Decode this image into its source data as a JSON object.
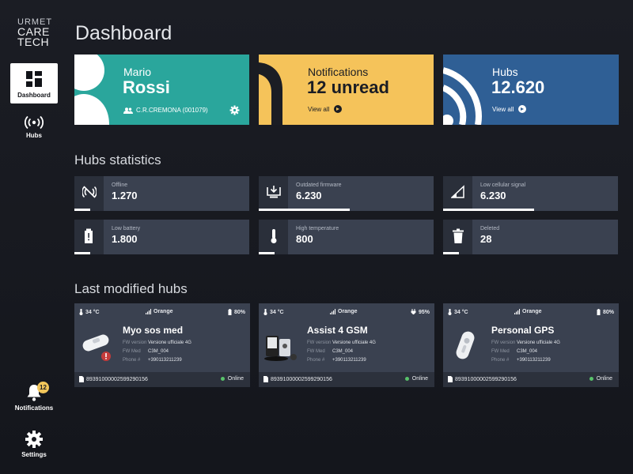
{
  "brand": {
    "line1": "URMET",
    "line2": "CARE",
    "line3": "TECH"
  },
  "sidebar": {
    "items": [
      {
        "label": "Dashboard",
        "icon": "dashboard-icon"
      },
      {
        "label": "Hubs",
        "icon": "hubs-icon"
      },
      {
        "label": "Notifications",
        "icon": "bell-icon",
        "badge": "12"
      },
      {
        "label": "Settings",
        "icon": "gear-icon"
      }
    ]
  },
  "page_title": "Dashboard",
  "cards": {
    "user": {
      "first_name": "Mario",
      "last_name": "Rossi",
      "group": "C.R.CREMONA (001079)"
    },
    "notifications": {
      "label": "Notifications",
      "value": "12 unread",
      "link": "View all"
    },
    "hubs": {
      "label": "Hubs",
      "value": "12.620",
      "link": "View all"
    }
  },
  "sections": {
    "stats": "Hubs statistics",
    "last_modified": "Last modified hubs"
  },
  "stats": [
    {
      "label": "Offline",
      "value": "1.270",
      "icon": "signal-off-icon",
      "fill": 0.09
    },
    {
      "label": "Outdated firmware",
      "value": "6.230",
      "icon": "download-icon",
      "fill": 0.52
    },
    {
      "label": "Low cellular signal",
      "value": "6.230",
      "icon": "low-signal-icon",
      "fill": 0.52
    },
    {
      "label": "Low battery",
      "value": "1.800",
      "icon": "battery-low-icon",
      "fill": 0.09
    },
    {
      "label": "High temperature",
      "value": "800",
      "icon": "thermometer-icon",
      "fill": 0.09
    },
    {
      "label": "Deleted",
      "value": "28",
      "icon": "trash-icon",
      "fill": 0.09
    }
  ],
  "hubs": [
    {
      "temp": "34 °C",
      "network": "Orange",
      "battery": "80%",
      "battery_icon": "battery-icon",
      "name": "Myo sos med",
      "fw_label": "FW version",
      "fw": "Versione ufficiale 4G",
      "fwmed_label": "FW Med",
      "fwmed": "C3M_004",
      "phone_label": "Phone #",
      "phone": "+390113211239",
      "imei": "89391000002599290156",
      "status": "Online"
    },
    {
      "temp": "34 °C",
      "network": "Orange",
      "battery": "95%",
      "battery_icon": "plug-icon",
      "name": "Assist 4 GSM",
      "fw_label": "FW version",
      "fw": "Versione ufficiale 4G",
      "fwmed_label": "FW Med",
      "fwmed": "C3M_004",
      "phone_label": "Phone #",
      "phone": "+390113211239",
      "imei": "89391000002599290156",
      "status": "Online"
    },
    {
      "temp": "34 °C",
      "network": "Orange",
      "battery": "80%",
      "battery_icon": "battery-icon",
      "name": "Personal GPS",
      "fw_label": "FW version",
      "fw": "Versione ufficiale 4G",
      "fwmed_label": "FW Med",
      "fwmed": "C3M_004",
      "phone_label": "Phone #",
      "phone": "+390113211239",
      "imei": "89391000002599290156",
      "status": "Online"
    }
  ],
  "colors": {
    "teal": "#2aa69c",
    "yellow": "#f5c35a",
    "blue": "#2f5f95",
    "card": "#3a4150",
    "online": "#58c26a"
  }
}
